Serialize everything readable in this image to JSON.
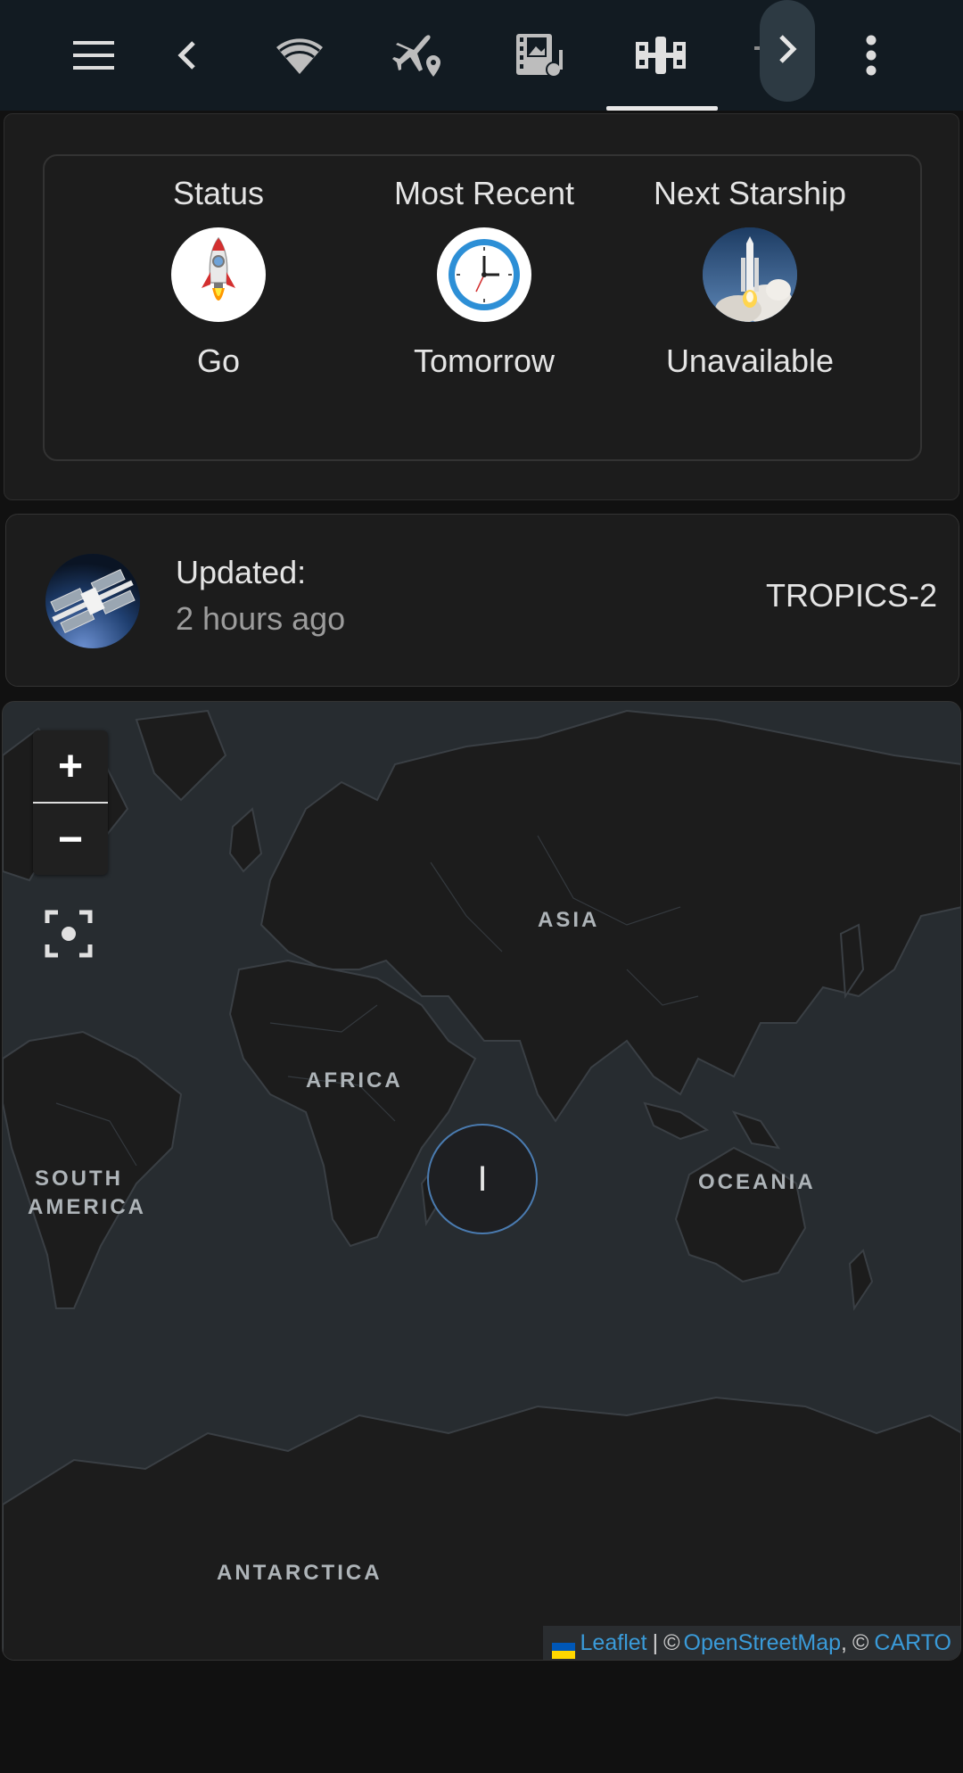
{
  "toolbar": {
    "icons": [
      "menu-icon",
      "chevron-left-icon",
      "wifi-icon",
      "airplane-location-icon",
      "film-music-icon",
      "satellite-icon",
      "chevron-right-icon",
      "more-vertical-icon"
    ],
    "active_tab": "satellite-icon",
    "underline_color": "#e8e8e8"
  },
  "status_panel": {
    "items": [
      {
        "label": "Status",
        "value": "Go",
        "icon": "rocket-icon"
      },
      {
        "label": "Most Recent",
        "value": "Tomorrow",
        "icon": "clock-icon"
      },
      {
        "label": "Next Starship",
        "value": "Unavailable",
        "icon": "launch-photo-icon"
      }
    ]
  },
  "update_card": {
    "label": "Updated:",
    "time": "2 hours ago",
    "name": "TROPICS-2",
    "avatar": "space-station-icon"
  },
  "map": {
    "zoom_in": "+",
    "zoom_out": "−",
    "labels": {
      "asia": "ASIA",
      "africa": "AFRICA",
      "south_america_1": "SOUTH",
      "south_america_2": "AMERICA",
      "oceania": "OCEANIA",
      "antarctica": "ANTARCTICA"
    },
    "marker_text": "I",
    "attribution": {
      "leaflet": "Leaflet",
      "sep": "|",
      "copy1": "©",
      "osm": "OpenStreetMap",
      "comma": ",",
      "copy2": "©",
      "carto": "CARTO"
    },
    "colors": {
      "ocean": "#272c30",
      "land": "#1c1c1c",
      "marker_border": "#4a7bb0",
      "link": "#3a9bd9"
    }
  }
}
